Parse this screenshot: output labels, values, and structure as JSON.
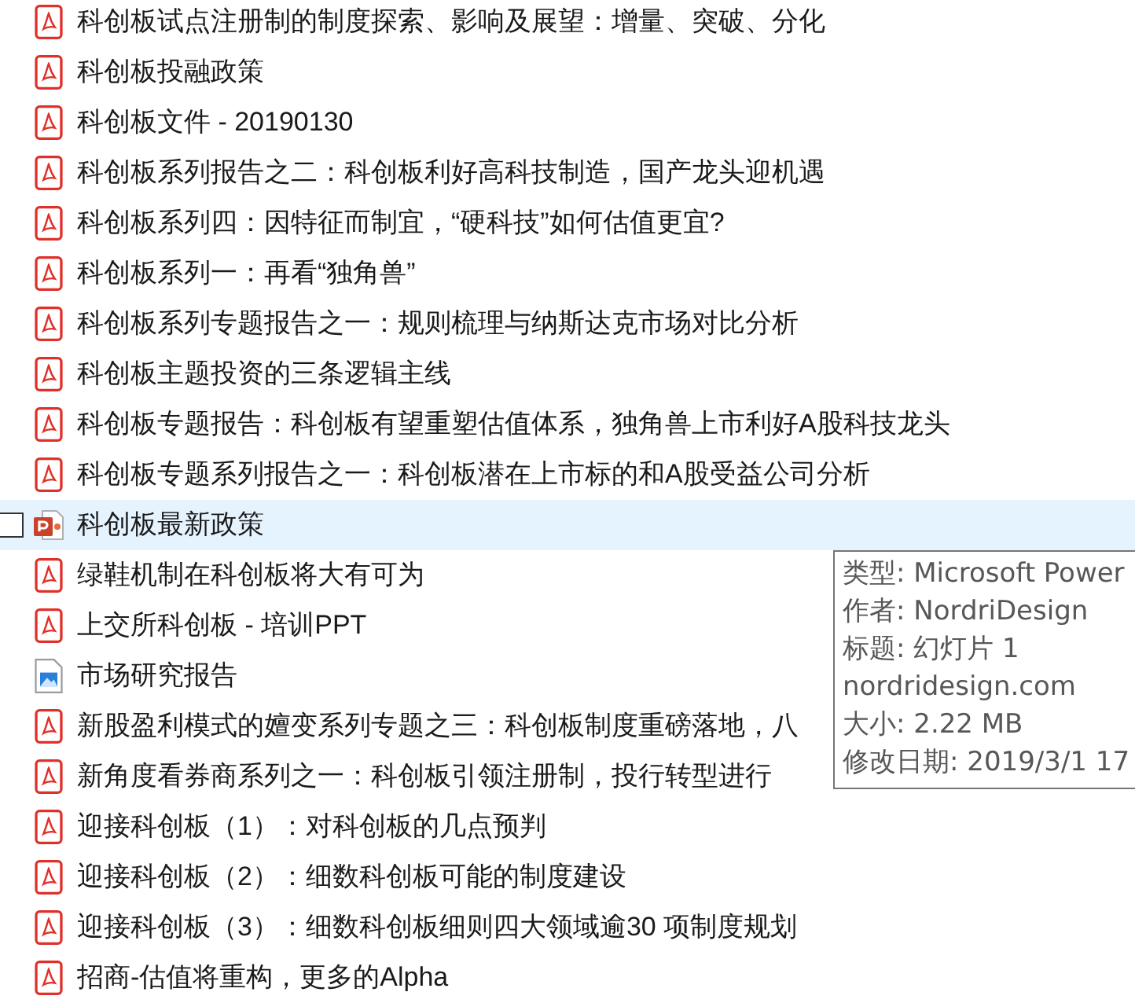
{
  "files": [
    {
      "name": "科创板试点注册制的制度探索、影响及展望：增量、突破、分化",
      "kind": "pdf",
      "selected": false
    },
    {
      "name": "科创板投融政策",
      "kind": "pdf",
      "selected": false
    },
    {
      "name": "科创板文件 - 20190130",
      "kind": "pdf",
      "selected": false
    },
    {
      "name": "科创板系列报告之二：科创板利好高科技制造，国产龙头迎机遇",
      "kind": "pdf",
      "selected": false
    },
    {
      "name": "科创板系列四：因特征而制宜，“硬科技”如何估值更宜?",
      "kind": "pdf",
      "selected": false
    },
    {
      "name": "科创板系列一：再看“独角兽”",
      "kind": "pdf",
      "selected": false
    },
    {
      "name": "科创板系列专题报告之一：规则梳理与纳斯达克市场对比分析",
      "kind": "pdf",
      "selected": false
    },
    {
      "name": "科创板主题投资的三条逻辑主线",
      "kind": "pdf",
      "selected": false
    },
    {
      "name": "科创板专题报告：科创板有望重塑估值体系，独角兽上市利好A股科技龙头",
      "kind": "pdf",
      "selected": false
    },
    {
      "name": "科创板专题系列报告之一：科创板潜在上市标的和A股受益公司分析",
      "kind": "pdf",
      "selected": false
    },
    {
      "name": "科创板最新政策",
      "kind": "ppt",
      "selected": true
    },
    {
      "name": "绿鞋机制在科创板将大有可为",
      "kind": "pdf",
      "selected": false
    },
    {
      "name": "上交所科创板 - 培训PPT",
      "kind": "pdf",
      "selected": false
    },
    {
      "name": "市场研究报告",
      "kind": "image",
      "selected": false
    },
    {
      "name": "新股盈利模式的嬗变系列专题之三：科创板制度重磅落地，八",
      "kind": "pdf",
      "selected": false
    },
    {
      "name": "新角度看券商系列之一：科创板引领注册制，投行转型进行",
      "kind": "pdf",
      "selected": false
    },
    {
      "name": "迎接科创板（1）：对科创板的几点预判",
      "kind": "pdf",
      "selected": false
    },
    {
      "name": "迎接科创板（2）：细数科创板可能的制度建设",
      "kind": "pdf",
      "selected": false
    },
    {
      "name": "迎接科创板（3）：细数科创板细则四大领域逾30 项制度规划",
      "kind": "pdf",
      "selected": false
    },
    {
      "name": "招商-估值将重构，更多的Alpha",
      "kind": "pdf",
      "selected": false
    }
  ],
  "tooltip": {
    "lines": [
      "类型: Microsoft Power",
      "作者: NordriDesign",
      "标题: 幻灯片 1",
      "nordridesign.com",
      "大小: 2.22 MB",
      "修改日期: 2019/3/1 17"
    ]
  }
}
